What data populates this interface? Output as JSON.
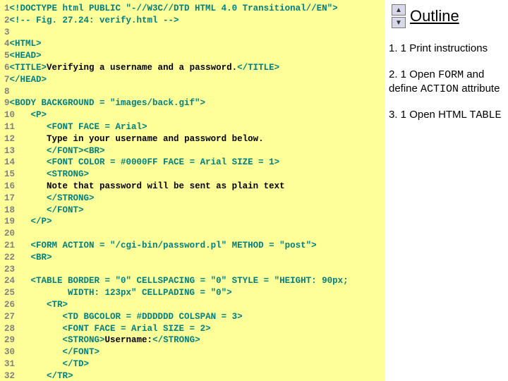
{
  "outline": {
    "title": "Outline",
    "items": [
      {
        "num": "1. 1",
        "text": "Print instructions"
      },
      {
        "num": "2. 1",
        "text_pre": "Open ",
        "code1": "FORM",
        "text_mid": " and define ",
        "code2": "ACTION",
        "text_post": " attribute"
      },
      {
        "num": "3. 1",
        "text_pre": "Open HTML ",
        "code1": "TABLE"
      }
    ]
  },
  "code": {
    "lines": [
      {
        "n": "1",
        "tag": "<!DOCTYPE html PUBLIC \"-//W3C//DTD HTML 4.0 Transitional//EN\">",
        "cls": "kw"
      },
      {
        "n": "2",
        "tag": "<!-- Fig. 27.24: verify.html -->",
        "cls": "cm"
      },
      {
        "n": "3",
        "tag": "",
        "cls": "kw"
      },
      {
        "n": "4",
        "tag": "<HTML>",
        "cls": "kw"
      },
      {
        "n": "5",
        "tag": "<HEAD>",
        "cls": "kw"
      },
      {
        "n": "6",
        "tag": "<TITLE>",
        "text": "Verifying a username and a password.",
        "endtag": "</TITLE>"
      },
      {
        "n": "7",
        "tag": "</HEAD>",
        "cls": "kw"
      },
      {
        "n": "8",
        "tag": "",
        "cls": "kw"
      },
      {
        "n": "9",
        "tag": "<BODY BACKGROUND = \"images/back.gif\">",
        "cls": "kw"
      },
      {
        "n": "10",
        "indent": "   ",
        "tag": "<P>",
        "cls": "kw"
      },
      {
        "n": "11",
        "indent": "      ",
        "tag": "<FONT FACE = Arial>",
        "cls": "kw"
      },
      {
        "n": "12",
        "indent": "      ",
        "text": "Type in your username and password below."
      },
      {
        "n": "13",
        "indent": "      ",
        "tag": "</FONT><BR>",
        "cls": "kw"
      },
      {
        "n": "14",
        "indent": "      ",
        "tag": "<FONT COLOR = #0000FF FACE = Arial SIZE = 1>",
        "cls": "kw"
      },
      {
        "n": "15",
        "indent": "      ",
        "tag": "<STRONG>",
        "cls": "kw"
      },
      {
        "n": "16",
        "indent": "      ",
        "text": "Note that password will be sent as plain text"
      },
      {
        "n": "17",
        "indent": "      ",
        "tag": "</STRONG>",
        "cls": "kw"
      },
      {
        "n": "18",
        "indent": "      ",
        "tag": "</FONT>",
        "cls": "kw"
      },
      {
        "n": "19",
        "indent": "   ",
        "tag": "</P>",
        "cls": "kw"
      },
      {
        "n": "20",
        "tag": "",
        "cls": "kw"
      },
      {
        "n": "21",
        "indent": "   ",
        "tag": "<FORM ACTION = \"/cgi-bin/password.pl\" METHOD = \"post\">",
        "cls": "kw"
      },
      {
        "n": "22",
        "indent": "   ",
        "tag": "<BR>",
        "cls": "kw"
      },
      {
        "n": "23",
        "tag": "",
        "cls": "kw"
      },
      {
        "n": "24",
        "indent": "   ",
        "tag": "<TABLE BORDER = \"0\" CELLSPACING = \"0\" STYLE = \"HEIGHT: 90px;",
        "cls": "kw"
      },
      {
        "n": "25",
        "indent": "          ",
        "tag": "WIDTH: 123px\" CELLPADING = \"0\">",
        "cls": "kw"
      },
      {
        "n": "26",
        "indent": "      ",
        "tag": "<TR>",
        "cls": "kw"
      },
      {
        "n": "27",
        "indent": "         ",
        "tag": "<TD BGCOLOR = #DDDDDD COLSPAN = 3>",
        "cls": "kw"
      },
      {
        "n": "28",
        "indent": "         ",
        "tag": "<FONT FACE = Arial SIZE = 2>",
        "cls": "kw"
      },
      {
        "n": "29",
        "indent": "         ",
        "tag": "<STRONG>",
        "text": "Username:",
        "endtag": "</STRONG>"
      },
      {
        "n": "30",
        "indent": "         ",
        "tag": "</FONT>",
        "cls": "kw"
      },
      {
        "n": "31",
        "indent": "         ",
        "tag": "</TD>",
        "cls": "kw"
      },
      {
        "n": "32",
        "indent": "      ",
        "tag": "</TR>",
        "cls": "kw"
      }
    ]
  }
}
